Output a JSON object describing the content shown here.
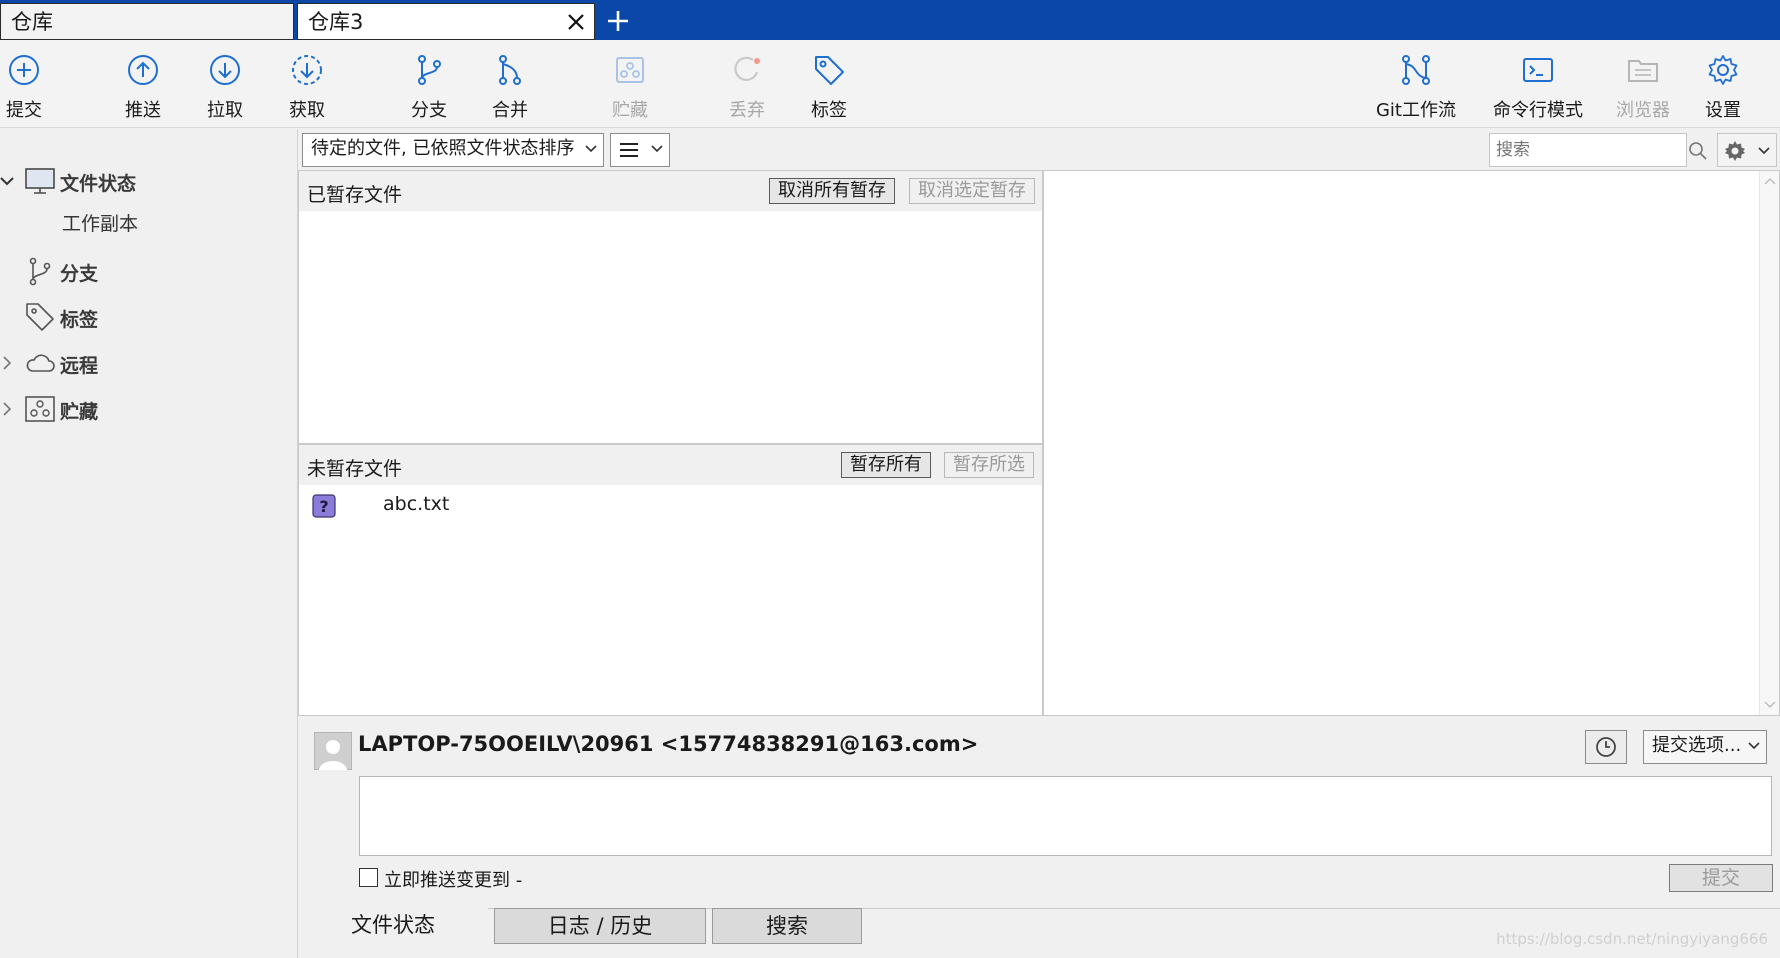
{
  "tabs": [
    {
      "label": "仓库",
      "active": false
    },
    {
      "label": "仓库3",
      "active": true
    }
  ],
  "toolbar": {
    "commit": "提交",
    "push": "推送",
    "pull": "拉取",
    "fetch": "获取",
    "branch": "分支",
    "merge": "合并",
    "stash": "贮藏",
    "discard": "丢弃",
    "tag": "标签",
    "gitflow": "Git工作流",
    "terminal": "命令行模式",
    "browser": "浏览器",
    "settings": "设置"
  },
  "sidebar": {
    "file_status": "文件状态",
    "working_copy": "工作副本",
    "branches": "分支",
    "tags": "标签",
    "remotes": "远程",
    "stashes": "贮藏"
  },
  "filter": {
    "sort_label": "待定的文件, 已依照文件状态排序",
    "search_placeholder": "搜索"
  },
  "staged": {
    "title": "已暂存文件",
    "unstage_all": "取消所有暂存",
    "unstage_selected": "取消选定暂存"
  },
  "unstaged": {
    "title": "未暂存文件",
    "stage_all": "暂存所有",
    "stage_selected": "暂存所选",
    "files": [
      {
        "name": "abc.txt",
        "status_icon": "question-icon"
      }
    ]
  },
  "commit": {
    "author": "LAPTOP-75OOEILV\\20961 <15774838291@163.com>",
    "options_label": "提交选项...",
    "push_immediately": "立即推送变更到 -",
    "submit": "提交"
  },
  "bottom_tabs": {
    "file_status": "文件状态",
    "log": "日志 / 历史",
    "search": "搜索"
  },
  "watermark": "https://blog.csdn.net/ningyiyang666",
  "colors": {
    "tab_bar": "#0a47a9",
    "icon_blue": "#1e6fd0",
    "untracked": "#8a7cd8"
  }
}
